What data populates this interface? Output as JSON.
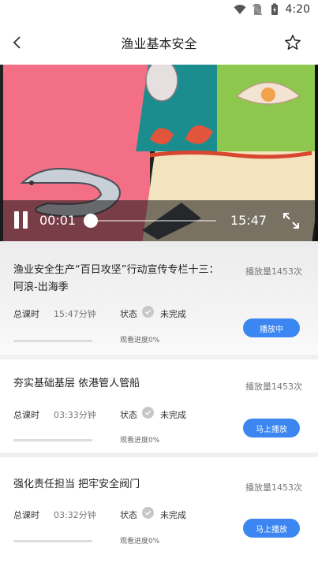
{
  "status_bar": {
    "time": "4:20"
  },
  "header": {
    "title": "渔业基本安全"
  },
  "video": {
    "current_time": "00:01",
    "total_time": "15:47",
    "progress": 0.02,
    "colors": {
      "pink": "#f26f86",
      "teal": "#1c8d8e",
      "green": "#8ec74e",
      "cream": "#f3e3bf",
      "orange": "#f0b43a"
    }
  },
  "lessons": [
    {
      "title": "渔业安全生产“百日攻坚”行动宣传专栏十三：阿浪-出海季",
      "plays": "播放量1453次",
      "duration_label": "总课时",
      "duration": "15:47分钟",
      "status_label": "状态",
      "status": "未完成",
      "watch_progress": "观看进度0%",
      "button": "播放中"
    },
    {
      "title": "夯实基础基层 依港管人管船",
      "plays": "播放量1453次",
      "duration_label": "总课时",
      "duration": "03:33分钟",
      "status_label": "状态",
      "status": "未完成",
      "watch_progress": "观看进度0%",
      "button": "马上播放"
    },
    {
      "title": "强化责任担当 把牢安全阀门",
      "plays": "播放量1453次",
      "duration_label": "总课时",
      "duration": "03:32分钟",
      "status_label": "状态",
      "status": "未完成",
      "watch_progress": "观看进度0%",
      "button": "马上播放"
    }
  ],
  "accent_color": "#3b86f0"
}
